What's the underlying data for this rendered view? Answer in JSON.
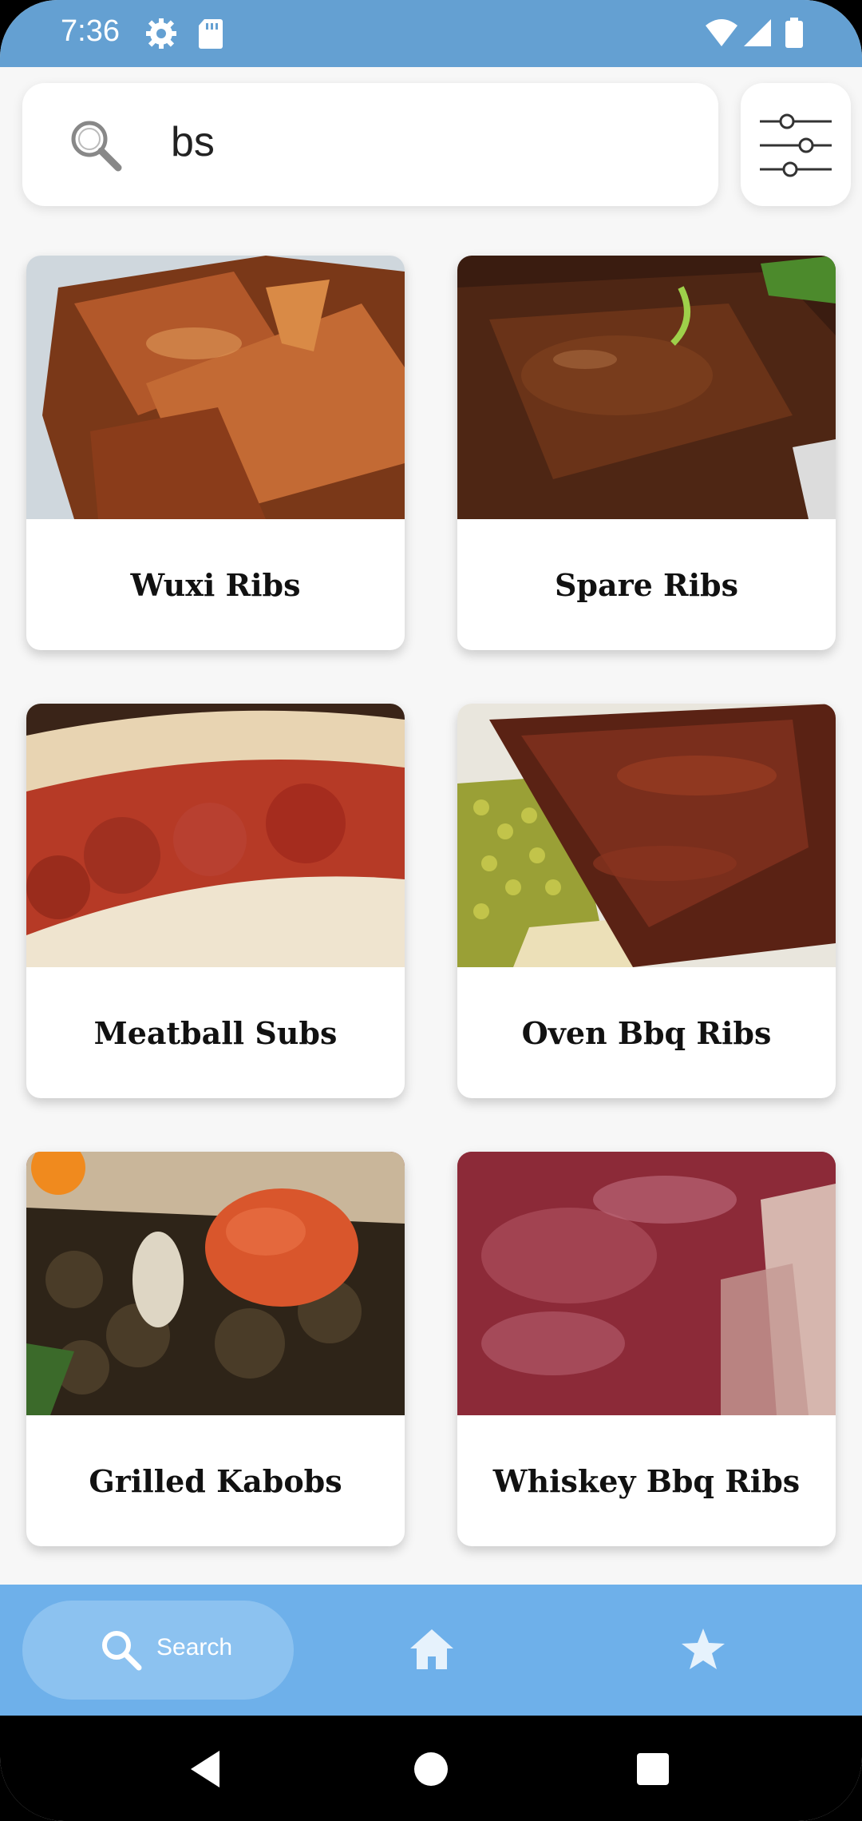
{
  "status_bar": {
    "time": "7:36",
    "icons": [
      "gear-icon",
      "sd-card-icon",
      "wifi-icon",
      "signal-icon",
      "battery-icon"
    ],
    "background": "#64a0d2"
  },
  "search": {
    "value": "bs",
    "icon": "search-icon",
    "filter_icon": "sliders-icon"
  },
  "results": [
    {
      "title": "Wuxi Ribs",
      "image": "ribs-glazed-photo"
    },
    {
      "title": "Spare Ribs",
      "image": "spare-ribs-photo"
    },
    {
      "title": "Meatball Subs",
      "image": "meatball-sub-photo"
    },
    {
      "title": "Oven Bbq Ribs",
      "image": "oven-bbq-ribs-photo"
    },
    {
      "title": "Grilled Kabobs",
      "image": "grilled-kabobs-photo"
    },
    {
      "title": "Whiskey Bbq Ribs",
      "image": "whiskey-bbq-ribs-photo"
    }
  ],
  "bottom_nav": {
    "items": [
      {
        "label": "Search",
        "icon": "search-icon",
        "active": true
      },
      {
        "label": "",
        "icon": "home-icon",
        "active": false
      },
      {
        "label": "",
        "icon": "star-icon",
        "active": false
      }
    ],
    "background": "#6eb0ea",
    "active_pill": "#8cc2f0"
  },
  "system_nav": {
    "icons": [
      "back-icon",
      "home-circle-icon",
      "recents-icon"
    ]
  }
}
